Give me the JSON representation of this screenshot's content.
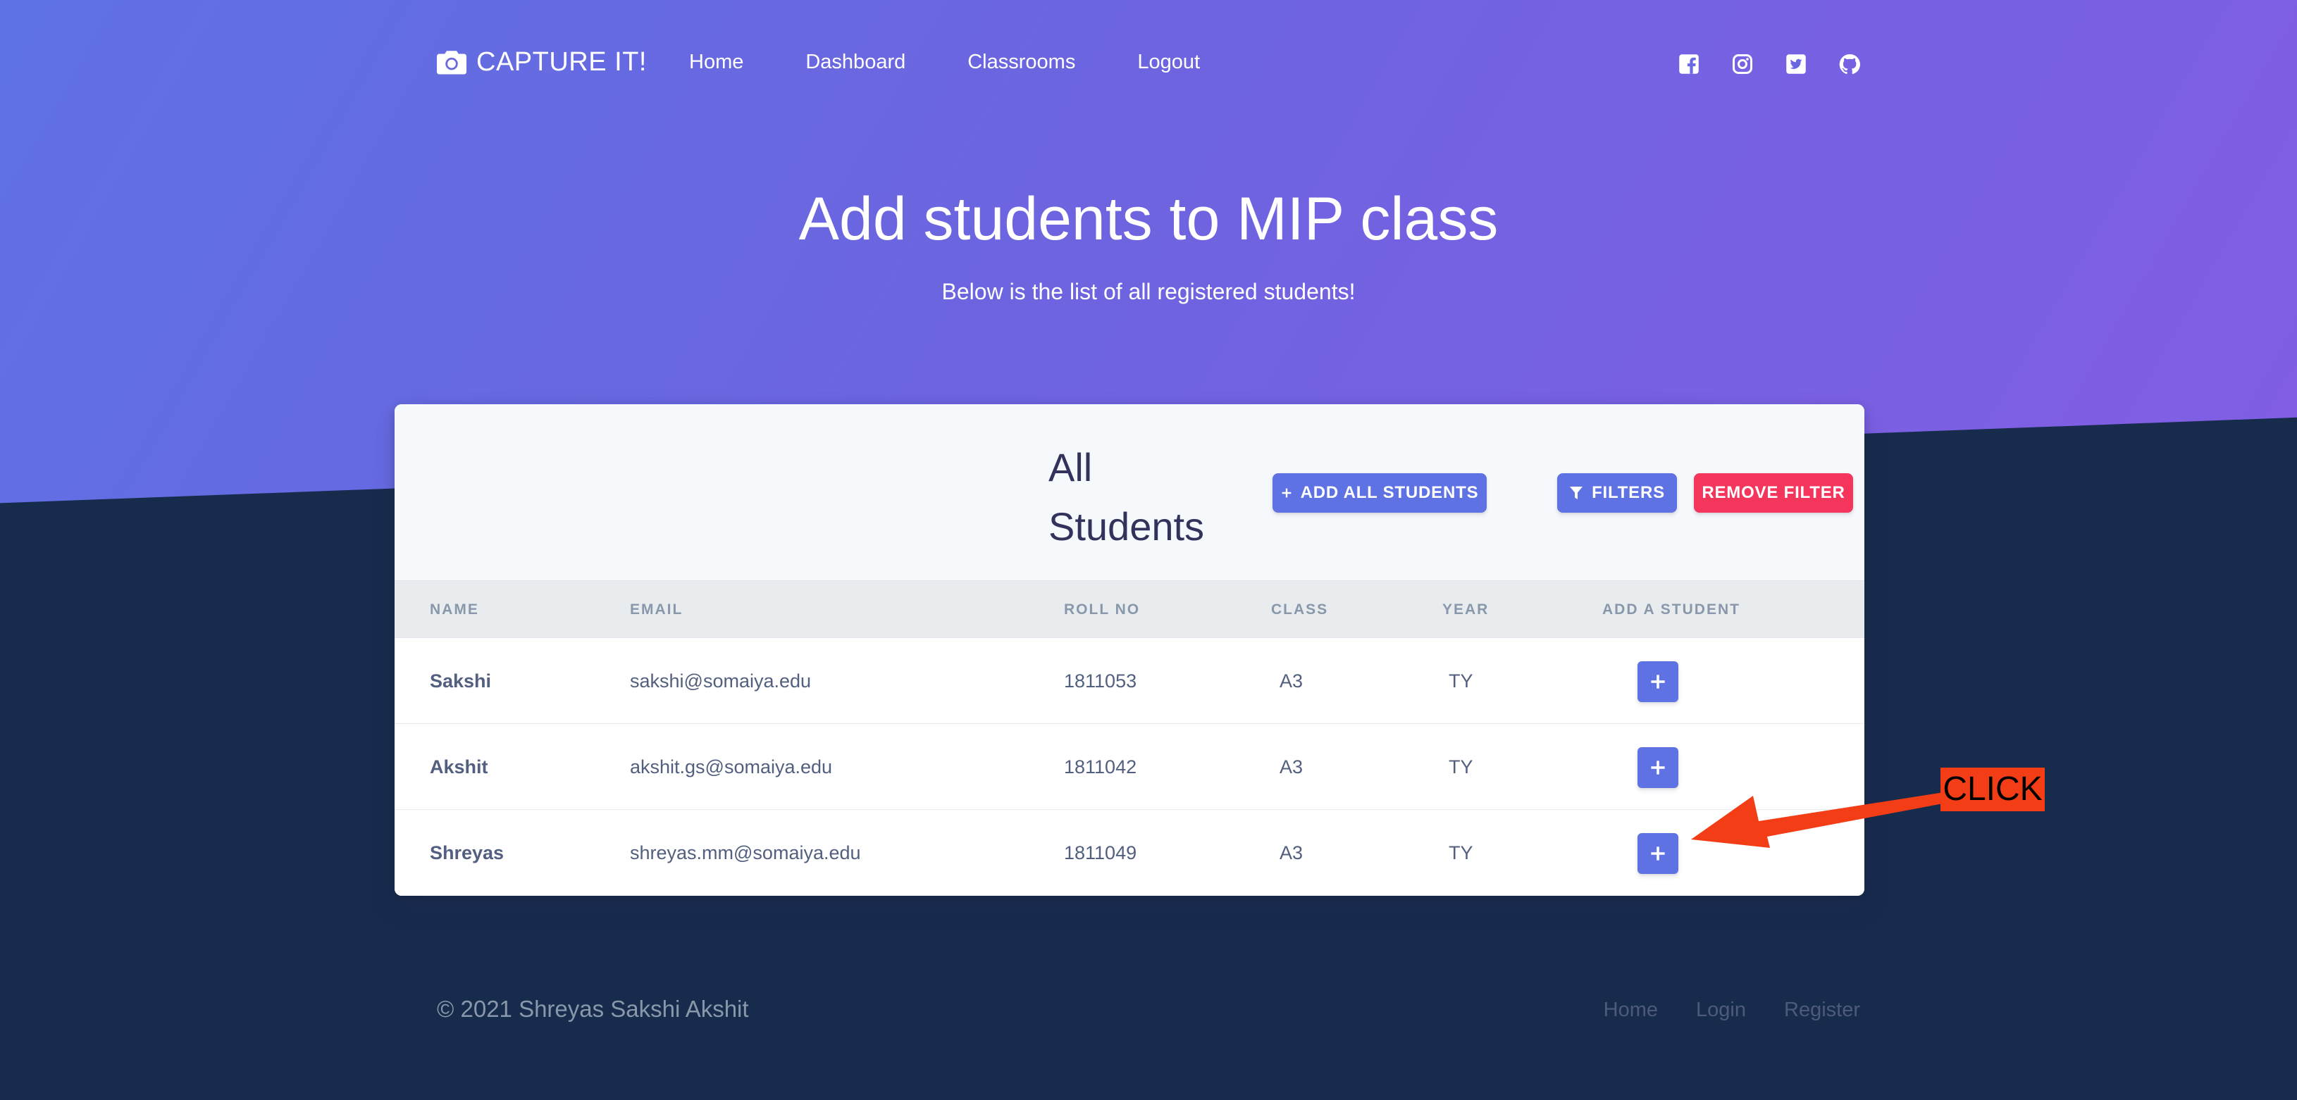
{
  "nav": {
    "brand": "CAPTURE IT!",
    "links": [
      "Home",
      "Dashboard",
      "Classrooms",
      "Logout"
    ],
    "social_icons": [
      "facebook-icon",
      "instagram-icon",
      "twitter-icon",
      "github-icon"
    ]
  },
  "hero": {
    "title": "Add students to MIP class",
    "subtitle": "Below is the list of all registered students!"
  },
  "card": {
    "title": "All Students",
    "add_all_label": "ADD ALL STUDENTS",
    "filters_label": "FILTERS",
    "remove_filter_label": "REMOVE FILTER"
  },
  "table": {
    "columns": [
      "NAME",
      "EMAIL",
      "ROLL NO",
      "CLASS",
      "YEAR",
      "ADD A STUDENT"
    ],
    "rows": [
      {
        "name": "Sakshi",
        "email": "sakshi@somaiya.edu",
        "roll": "1811053",
        "class": "A3",
        "year": "TY"
      },
      {
        "name": "Akshit",
        "email": "akshit.gs@somaiya.edu",
        "roll": "1811042",
        "class": "A3",
        "year": "TY"
      },
      {
        "name": "Shreyas",
        "email": "shreyas.mm@somaiya.edu",
        "roll": "1811049",
        "class": "A3",
        "year": "TY"
      }
    ]
  },
  "annotation": {
    "label": "CLICK"
  },
  "footer": {
    "copyright": "© 2021 Shreyas Sakshi Akshit",
    "links": [
      "Home",
      "Login",
      "Register"
    ]
  },
  "colors": {
    "primary": "#5e72e4",
    "danger": "#f5365c",
    "dark": "#172b4d",
    "annotation": "#f33d16"
  }
}
